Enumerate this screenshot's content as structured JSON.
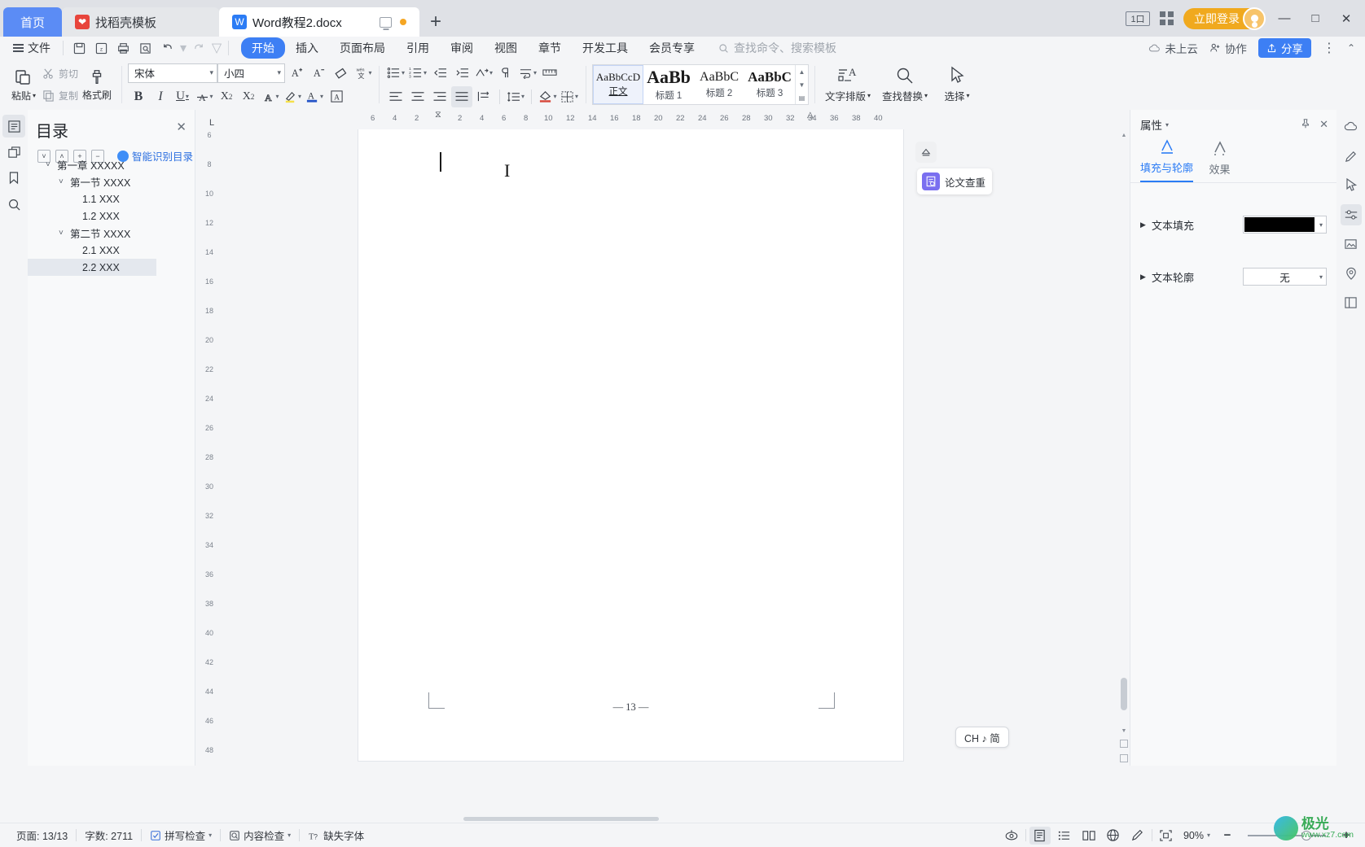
{
  "titlebar": {
    "tabs": [
      {
        "label": "首页",
        "type": "home"
      },
      {
        "label": "找稻壳模板",
        "type": "template",
        "icon": "dove-icon"
      },
      {
        "label": "Word教程2.docx",
        "type": "document",
        "icon": "word-icon"
      }
    ],
    "new_tab_label": "+",
    "page_count_badge": "1口",
    "login_label": "立即登录",
    "window_buttons": {
      "minimize": "—",
      "maximize": "□",
      "close": "✕"
    }
  },
  "menubar": {
    "file_label": "文件",
    "quick_access": [
      "save-icon",
      "save-as-icon",
      "print-icon",
      "print-preview-icon",
      "undo-icon",
      "redo-icon",
      "customize-icon"
    ],
    "items": [
      {
        "label": "开始",
        "active": true
      },
      {
        "label": "插入",
        "active": false
      },
      {
        "label": "页面布局",
        "active": false
      },
      {
        "label": "引用",
        "active": false
      },
      {
        "label": "审阅",
        "active": false
      },
      {
        "label": "视图",
        "active": false
      },
      {
        "label": "章节",
        "active": false
      },
      {
        "label": "开发工具",
        "active": false
      },
      {
        "label": "会员专享",
        "active": false
      }
    ],
    "search_placeholder": "查找命令、搜索模板",
    "cloud_status": "未上云",
    "collaborate": "协作",
    "share": "分享"
  },
  "ribbon": {
    "paste_label": "粘贴",
    "cut_label": "剪切",
    "copy_label": "复制",
    "format_painter_label": "格式刷",
    "font_name": "宋体",
    "font_size": "小四",
    "styles": [
      {
        "preview": "AaBbCcD",
        "name": "正文",
        "selected": true
      },
      {
        "preview": "AaBb",
        "name": "标题 1",
        "selected": false
      },
      {
        "preview": "AaBbC",
        "name": "标题 2",
        "selected": false
      },
      {
        "preview": "AaBbC",
        "name": "标题 3",
        "selected": false
      }
    ],
    "text_layout_label": "文字排版",
    "find_replace_label": "查找替换",
    "select_label": "选择"
  },
  "navpane": {
    "title": "目录",
    "smart_label": "智能识别目录",
    "items": [
      {
        "label": "第一章  XXXXX",
        "level": 0,
        "caret": "˅",
        "selected": false
      },
      {
        "label": "第一节  XXXX",
        "level": 1,
        "caret": "˅",
        "selected": false
      },
      {
        "label": "1.1 XXX",
        "level": 2,
        "caret": "",
        "selected": false
      },
      {
        "label": "1.2 XXX",
        "level": 2,
        "caret": "",
        "selected": false
      },
      {
        "label": "第二节  XXXX",
        "level": 1,
        "caret": "˅",
        "selected": false
      },
      {
        "label": "2.1 XXX",
        "level": 2,
        "caret": "",
        "selected": false
      },
      {
        "label": "2.2 XXX",
        "level": 2,
        "caret": "",
        "selected": true
      }
    ]
  },
  "rulers": {
    "horizontal_ticks": [
      "6",
      "4",
      "2",
      "2",
      "4",
      "6",
      "8",
      "10",
      "12",
      "14",
      "16",
      "18",
      "20",
      "22",
      "24",
      "26",
      "28",
      "30",
      "32",
      "34",
      "36",
      "38",
      "40"
    ],
    "vertical_ticks": [
      "6",
      "8",
      "10",
      "12",
      "14",
      "16",
      "18",
      "20",
      "22",
      "24",
      "26",
      "28",
      "30",
      "32",
      "34",
      "36",
      "38",
      "40",
      "42",
      "44",
      "46",
      "48"
    ]
  },
  "document": {
    "page_footer": "— 13 —"
  },
  "floating": {
    "paper_check_label": "论文查重",
    "ime_label": "CH ♪ 简"
  },
  "properties": {
    "title": "属性",
    "tabs": [
      {
        "label": "填充与轮廓",
        "active": true
      },
      {
        "label": "效果",
        "active": false
      }
    ],
    "rows": [
      {
        "label": "文本填充",
        "value": "",
        "type": "color",
        "color": "#000000"
      },
      {
        "label": "文本轮廓",
        "value": "无",
        "type": "select"
      }
    ]
  },
  "statusbar": {
    "page_info": "页面: 13/13",
    "word_count": "字数: 2711",
    "spell_check": "拼写检查",
    "content_check": "内容检查",
    "missing_font": "缺失字体",
    "zoom_level": "90%",
    "view_modes": [
      "page-view-icon",
      "outline-view-icon",
      "reading-view-icon",
      "web-view-icon",
      "edit-view-icon"
    ]
  },
  "watermark": {
    "line1": "极光",
    "line2": "www.xz7.com"
  }
}
